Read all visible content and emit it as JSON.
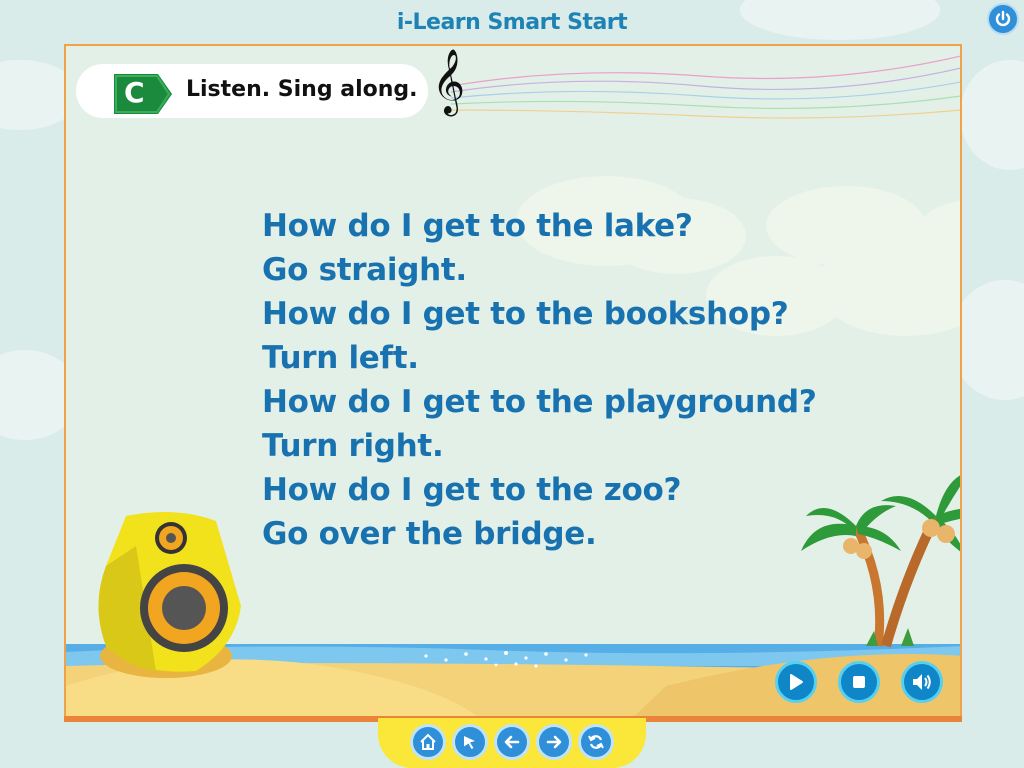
{
  "app": {
    "title": "i-Learn Smart Start"
  },
  "instruction": {
    "badge_letter": "C",
    "text": "Listen. Sing along."
  },
  "lyrics": [
    "How do I get to the lake?",
    "Go straight.",
    "How do I get to the bookshop?",
    "Turn left.",
    "How do I get to the playground?",
    "Turn right.",
    "How do I get to the zoo?",
    "Go over the bridge."
  ],
  "controls": {
    "icons": [
      "play-icon",
      "stop-icon",
      "volume-icon"
    ]
  },
  "navigation": {
    "icons": [
      "home-icon",
      "pointer-icon",
      "back-arrow-icon",
      "forward-arrow-icon",
      "refresh-icon"
    ]
  },
  "colors": {
    "accent": "#1972b0",
    "border": "#f0a248",
    "nav_bar": "#fbe63a",
    "badge": "#1b8a3c"
  }
}
